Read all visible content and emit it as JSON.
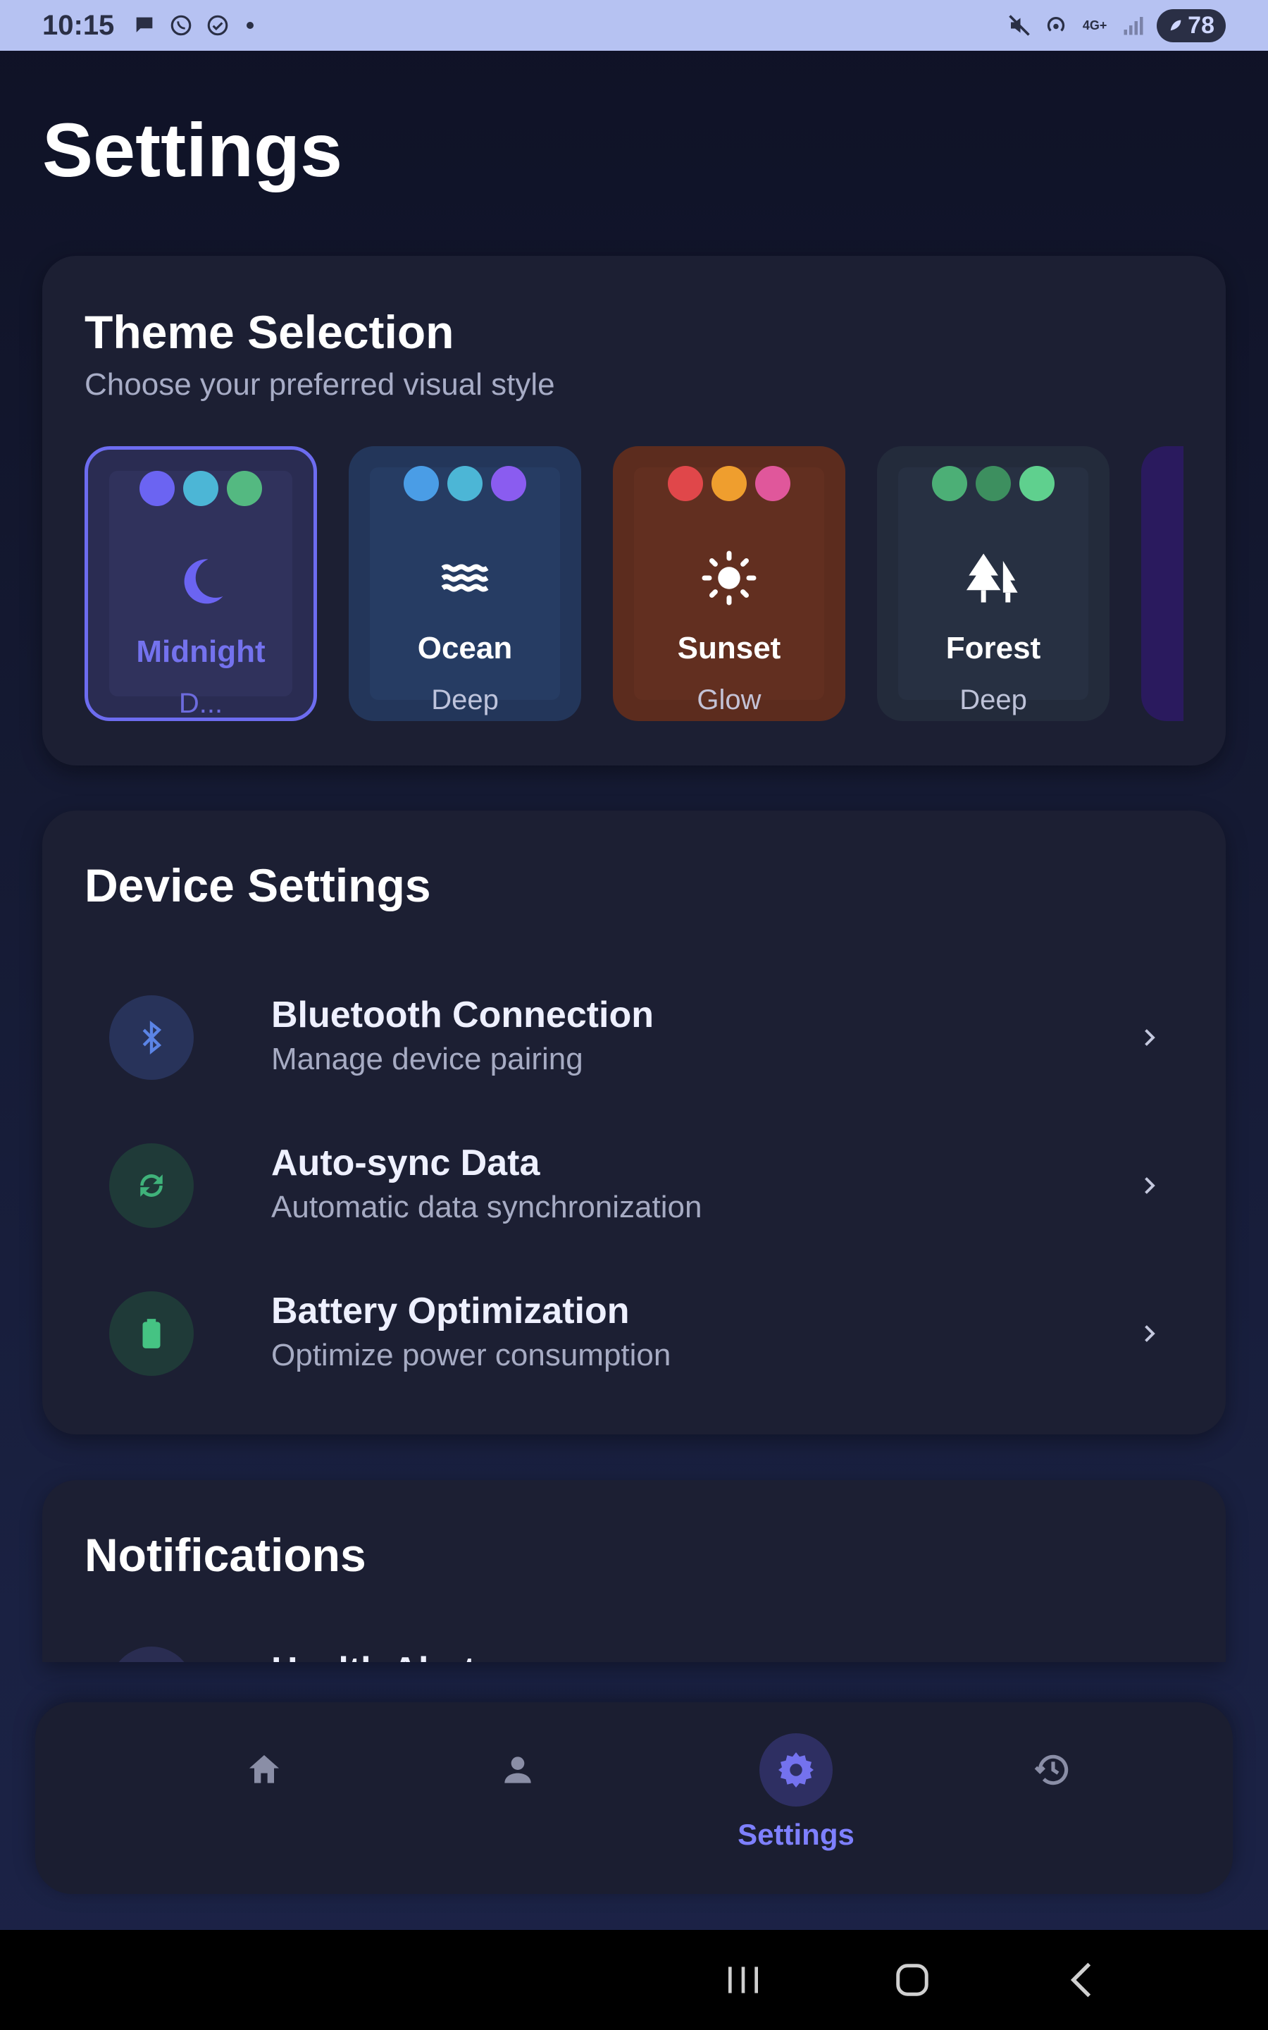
{
  "status_bar": {
    "time": "10:15",
    "left_icons": [
      "chat-bubble-icon",
      "whatsapp-icon",
      "check-circle-icon"
    ],
    "right_icons": [
      "mute-icon",
      "hotspot-icon",
      "4g-data-icon",
      "signal-icon"
    ],
    "network_label": "4G+",
    "battery": "78"
  },
  "page": {
    "title": "Settings"
  },
  "theme_section": {
    "title": "Theme Selection",
    "subtitle": "Choose your preferred visual style",
    "selected": "Midnight",
    "themes": [
      {
        "label": "Midnight",
        "sub": "D...",
        "icon": "moon-icon",
        "bg": "#2a2c52",
        "inner": "#30325c",
        "label_color": "#7472ee",
        "dots": [
          "#6b64f2",
          "#4cb6d6",
          "#54b981"
        ]
      },
      {
        "label": "Ocean",
        "sub": "Deep",
        "icon": "waves-icon",
        "bg": "#23365a",
        "inner": "#263c63",
        "label_color": "#ffffff",
        "dots": [
          "#4a9de6",
          "#4cb6d6",
          "#8a5cf0"
        ]
      },
      {
        "label": "Sunset",
        "sub": "Glow",
        "icon": "sun-icon",
        "bg": "#5c2c1e",
        "inner": "#622f20",
        "label_color": "#ffffff",
        "dots": [
          "#e0474a",
          "#ef9e2e",
          "#e0579b"
        ]
      },
      {
        "label": "Forest",
        "sub": "Deep",
        "icon": "trees-icon",
        "bg": "#232b3b",
        "inner": "#273042",
        "label_color": "#ffffff",
        "dots": [
          "#4caf76",
          "#3d8f5f",
          "#5fd08e"
        ]
      }
    ]
  },
  "device_section": {
    "title": "Device Settings",
    "items": [
      {
        "title": "Bluetooth Connection",
        "sub": "Manage device pairing",
        "icon": "bluetooth-icon"
      },
      {
        "title": "Auto-sync Data",
        "sub": "Automatic data synchronization",
        "icon": "sync-icon"
      },
      {
        "title": "Battery Optimization",
        "sub": "Optimize power consumption",
        "icon": "battery-icon"
      }
    ]
  },
  "notifications_section": {
    "title": "Notifications",
    "partial_item": "Health Alerts"
  },
  "bottom_nav": {
    "active": "Settings",
    "items": [
      {
        "icon": "home-icon",
        "label": ""
      },
      {
        "icon": "profile-icon",
        "label": ""
      },
      {
        "icon": "settings-gear-icon",
        "label": "Settings"
      },
      {
        "icon": "history-icon",
        "label": ""
      }
    ]
  },
  "colors": {
    "accent": "#7472ee",
    "card": "#1c1f33",
    "status_bar": "#b6c2f2"
  }
}
